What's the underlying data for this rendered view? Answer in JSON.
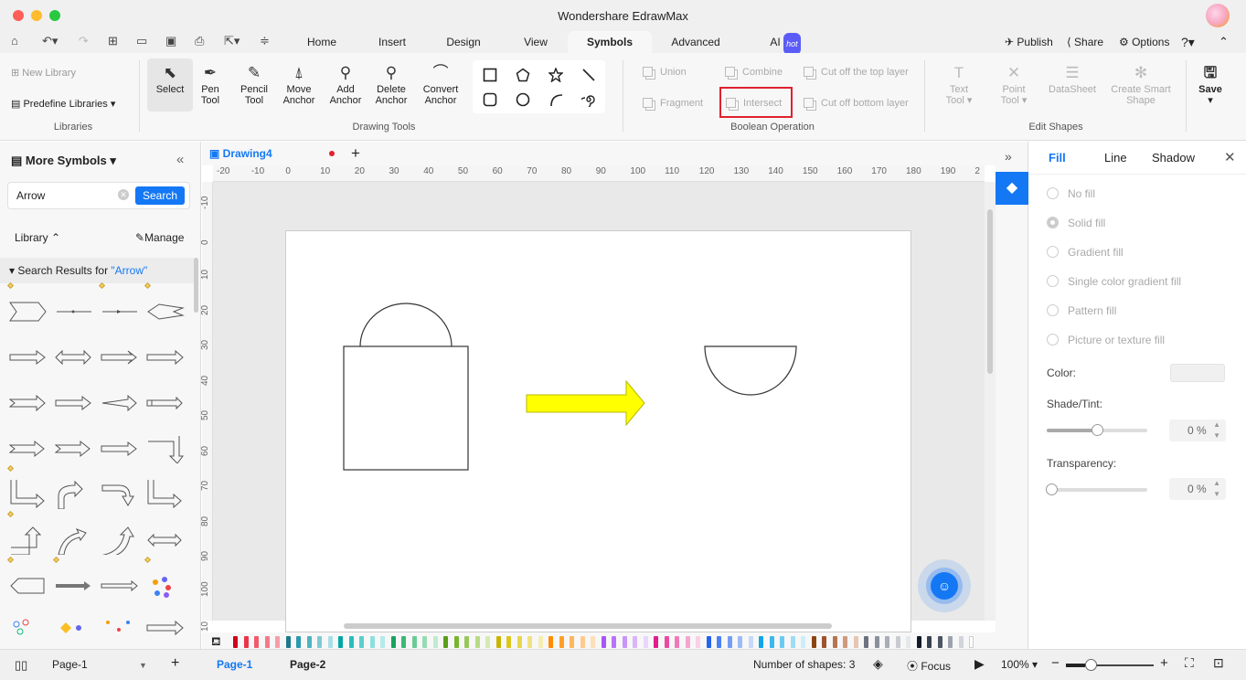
{
  "window": {
    "title": "Wondershare EdrawMax"
  },
  "menu": {
    "tabs": [
      "Home",
      "Insert",
      "Design",
      "View",
      "Symbols",
      "Advanced",
      "AI"
    ],
    "active": "Symbols",
    "ai_badge": "hot",
    "publish": "Publish",
    "share": "Share",
    "options": "Options"
  },
  "ribbon": {
    "new_library": "New Library",
    "predefine": "Predefine Libraries",
    "libraries_group": "Libraries",
    "tools": [
      {
        "l1": "Select",
        "l2": ""
      },
      {
        "l1": "Pen",
        "l2": "Tool"
      },
      {
        "l1": "Pencil",
        "l2": "Tool"
      },
      {
        "l1": "Move",
        "l2": "Anchor"
      },
      {
        "l1": "Add",
        "l2": "Anchor"
      },
      {
        "l1": "Delete",
        "l2": "Anchor"
      },
      {
        "l1": "Convert",
        "l2": "Anchor"
      }
    ],
    "drawing_group": "Drawing Tools",
    "boolean": {
      "union": "Union",
      "combine": "Combine",
      "cut_top": "Cut off the top layer",
      "fragment": "Fragment",
      "intersect": "Intersect",
      "cut_bottom": "Cut off bottom layer",
      "group": "Boolean Operation"
    },
    "edit": {
      "text_tool_1": "Text",
      "text_tool_2": "Tool",
      "point_tool_1": "Point",
      "point_tool_2": "Tool",
      "datasheet": "DataSheet",
      "smart_1": "Create Smart",
      "smart_2": "Shape",
      "group": "Edit Shapes"
    },
    "save": "Save"
  },
  "left": {
    "title": "More Symbols",
    "search_value": "Arrow",
    "search_btn": "Search",
    "library": "Library",
    "manage": "Manage",
    "results_prefix": "Search Results for ",
    "results_term": "\"Arrow\""
  },
  "canvas": {
    "doc_tab": "Drawing4",
    "ruler_h": [
      "-20",
      "-10",
      "0",
      "10",
      "20",
      "30",
      "40",
      "50",
      "60",
      "70",
      "80",
      "90",
      "100",
      "110",
      "120",
      "130",
      "140",
      "150",
      "160",
      "170",
      "180",
      "190",
      "2"
    ],
    "ruler_v": [
      "-10",
      "0",
      "10",
      "20",
      "30",
      "40",
      "50",
      "60",
      "70",
      "80",
      "90",
      "100",
      "10"
    ]
  },
  "right": {
    "tabs": [
      "Fill",
      "Line",
      "Shadow"
    ],
    "active": "Fill",
    "fill_options": [
      "No fill",
      "Solid fill",
      "Gradient fill",
      "Single color gradient fill",
      "Pattern fill",
      "Picture or texture fill"
    ],
    "color_label": "Color:",
    "shade_label": "Shade/Tint:",
    "shade_value": "0 %",
    "transparency_label": "Transparency:",
    "transparency_value": "0 %",
    "shade_level": 0.5,
    "transparency_level": 0
  },
  "status": {
    "page_select": "Page-1",
    "pages": [
      "Page-1",
      "Page-2"
    ],
    "shapes": "Number of shapes: 3",
    "focus": "Focus",
    "zoom": "100%"
  },
  "colors": {
    "accent": "#1478f5",
    "highlight": "#e0212f",
    "arrow_fill": "#ffff00"
  }
}
